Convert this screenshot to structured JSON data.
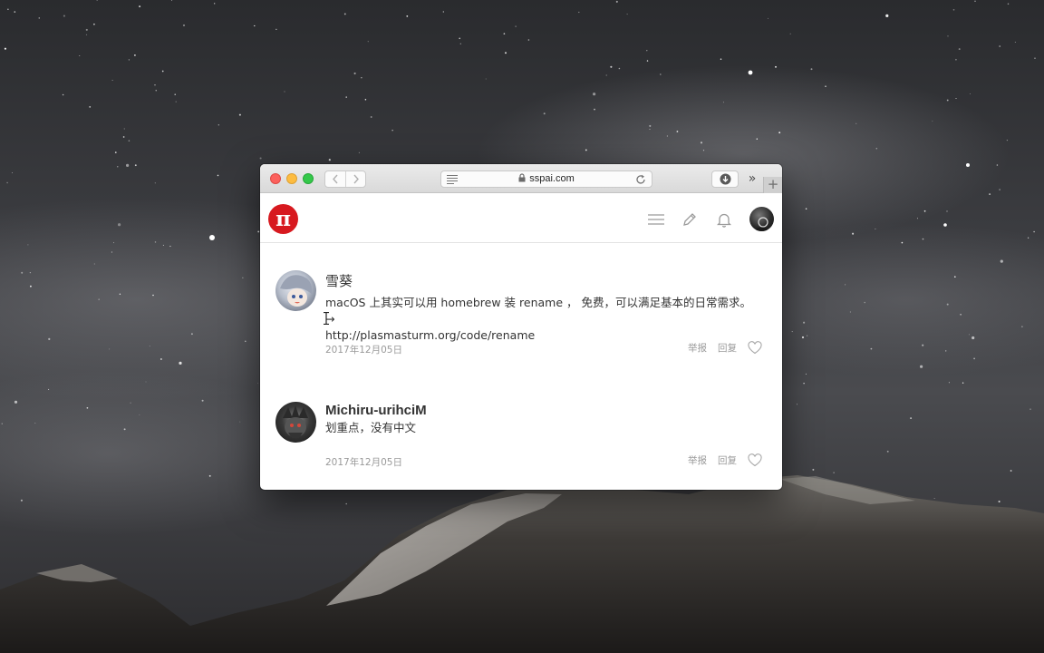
{
  "browser": {
    "url": "sspai.com",
    "more_glyph": "»",
    "newtab_glyph": "+"
  },
  "site": {
    "logo_glyph": "π",
    "brand_color": "#d7191f"
  },
  "comments": [
    {
      "author": "雪葵",
      "text": "macOS 上其实可以用 homebrew 装 rename ， 免费，可以满足基本的日常需求。→",
      "link": "http://plasmasturm.org/code/rename",
      "date": "2017年12月05日",
      "report": "举报",
      "reply": "回复"
    },
    {
      "author": "Michiru-urihciM",
      "text": "划重点，没有中文",
      "date": "2017年12月05日",
      "report": "举报",
      "reply": "回复"
    }
  ]
}
